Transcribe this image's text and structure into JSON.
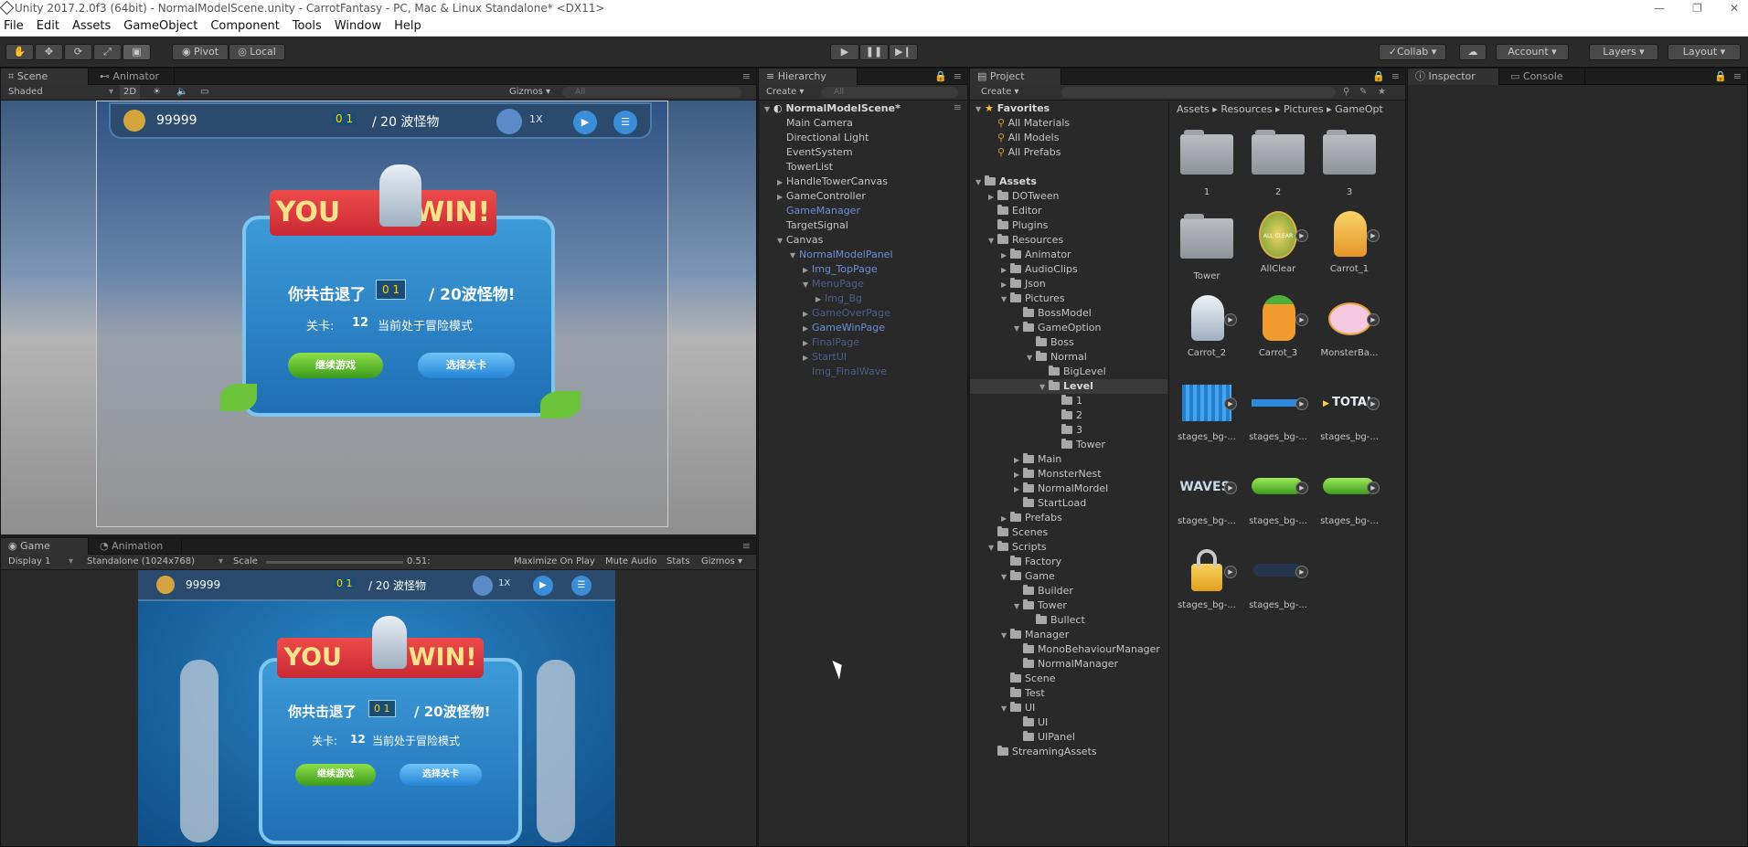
{
  "window": {
    "title": "Unity 2017.2.0f3 (64bit) - NormalModelScene.unity - CarrotFantasy - PC, Mac & Linux Standalone* <DX11>"
  },
  "menu": [
    "File",
    "Edit",
    "Assets",
    "GameObject",
    "Component",
    "Tools",
    "Window",
    "Help"
  ],
  "toolbar": {
    "pivot": "Pivot",
    "local": "Local",
    "collab": "Collab",
    "account": "Account",
    "layers": "Layers",
    "layout": "Layout"
  },
  "scene": {
    "tab_scene": "Scene",
    "tab_animator": "Animator",
    "shaded": "Shaded",
    "mode2d": "2D",
    "gizmos": "Gizmos",
    "search_placeholder": "All"
  },
  "game": {
    "tab_game": "Game",
    "tab_animation": "Animation",
    "display": "Display 1",
    "resolution": "Standalone (1024x768)",
    "scale_label": "Scale",
    "scale_value": "0.51:",
    "maximize": "Maximize On Play",
    "mute": "Mute Audio",
    "stats": "Stats",
    "gizmos": "Gizmos"
  },
  "game_ui": {
    "coins": "99999",
    "wave_digits": "0 1",
    "wave_total": "/ 20 波怪物",
    "speed": "1X",
    "you": "YOU",
    "win": "WIN!",
    "defeat_prefix": "你共击退了",
    "defeat_suffix": "/ 20波怪物!",
    "level_label": "关卡:",
    "level_num": "12",
    "mode_text": "当前处于冒险模式",
    "continue_btn": "继续游戏",
    "select_btn": "选择关卡"
  },
  "hierarchy": {
    "tab": "Hierarchy",
    "create": "Create",
    "search_placeholder": "All",
    "scene_name": "NormalModelScene*",
    "items": [
      {
        "label": "Main Camera"
      },
      {
        "label": "Directional Light"
      },
      {
        "label": "EventSystem"
      },
      {
        "label": "TowerList"
      },
      {
        "label": "HandleTowerCanvas"
      },
      {
        "label": "GameController"
      },
      {
        "label": "GameManager"
      },
      {
        "label": "TargetSignal"
      },
      {
        "label": "Canvas"
      },
      {
        "label": "NormalModelPanel"
      },
      {
        "label": "Img_TopPage"
      },
      {
        "label": "MenuPage"
      },
      {
        "label": "Img_Bg"
      },
      {
        "label": "GameOverPage"
      },
      {
        "label": "GameWinPage"
      },
      {
        "label": "FinalPage"
      },
      {
        "label": "StartUI"
      },
      {
        "label": "Img_FinalWave"
      }
    ]
  },
  "project": {
    "tab": "Project",
    "create": "Create",
    "favorites": "Favorites",
    "fav_items": [
      "All Materials",
      "All Models",
      "All Prefabs"
    ],
    "assets_root": "Assets",
    "tree": [
      "DOTween",
      "Editor",
      "Plugins",
      "Resources",
      "Animator",
      "AudioClips",
      "Json",
      "Pictures",
      "BossModel",
      "GameOption",
      "Boss",
      "Normal",
      "BigLevel",
      "Level",
      "1",
      "2",
      "3",
      "Tower",
      "Main",
      "MonsterNest",
      "NormalMordel",
      "StartLoad",
      "Prefabs",
      "Scenes",
      "Scripts",
      "Factory",
      "Game",
      "Builder",
      "Tower",
      "Bullect",
      "Manager",
      "MonoBehaviourManager",
      "NormalManager",
      "Scene",
      "Test",
      "UI",
      "UI",
      "UIPanel",
      "StreamingAssets"
    ],
    "breadcrumb": [
      "Assets",
      "Resources",
      "Pictures",
      "GameOpt"
    ],
    "assets": [
      {
        "label": "1",
        "kind": "folder"
      },
      {
        "label": "2",
        "kind": "folder"
      },
      {
        "label": "3",
        "kind": "folder"
      },
      {
        "label": "Tower",
        "kind": "folder"
      },
      {
        "label": "AllClear",
        "kind": "badge"
      },
      {
        "label": "Carrot_1",
        "kind": "carrot"
      },
      {
        "label": "Carrot_2",
        "kind": "carrot"
      },
      {
        "label": "Carrot_3",
        "kind": "carrot"
      },
      {
        "label": "MonsterBa...",
        "kind": "monster"
      },
      {
        "label": "stages_bg-...",
        "kind": "curtain"
      },
      {
        "label": "stages_bg-...",
        "kind": "bar"
      },
      {
        "label": "stages_bg-...",
        "kind": "total"
      },
      {
        "label": "stages_bg-...",
        "kind": "waves"
      },
      {
        "label": "stages_bg-...",
        "kind": "greenbtn"
      },
      {
        "label": "stages_bg-...",
        "kind": "greenbtn"
      },
      {
        "label": "stages_bg-...",
        "kind": "lock"
      },
      {
        "label": "stages_bg-...",
        "kind": "darkpill"
      }
    ],
    "total_text": "TOTAL",
    "waves_text": "WAVES",
    "allclear_text": "ALL CLEAR"
  },
  "inspector": {
    "tab_inspector": "Inspector",
    "tab_console": "Console"
  },
  "colors": {
    "accent_blue": "#6f8fd6",
    "panel_bg": "#2a2a2a",
    "game_blue": "#1f6fb5"
  }
}
